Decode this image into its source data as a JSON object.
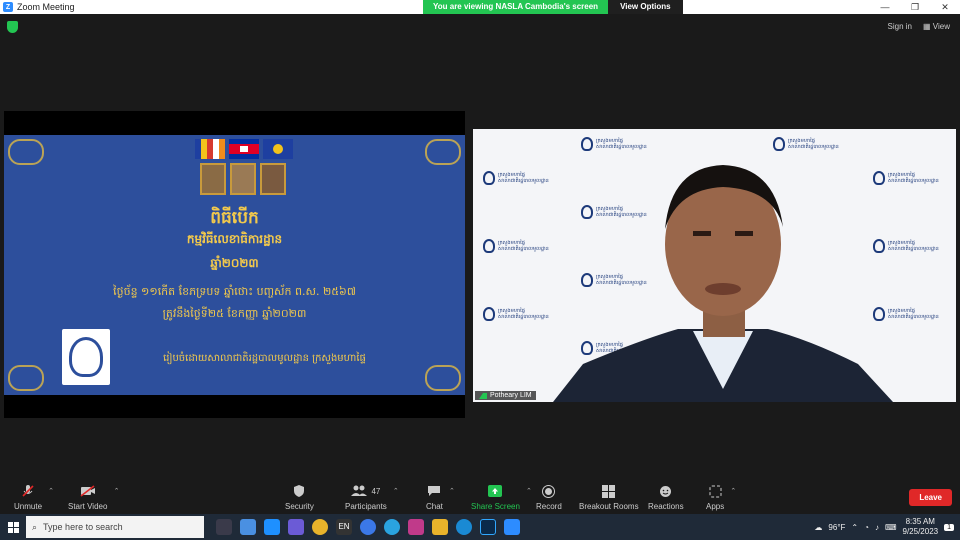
{
  "window": {
    "title": "Zoom Meeting",
    "controls": [
      "—",
      "❐",
      "✕"
    ]
  },
  "banner": {
    "message": "You are viewing NASLA Cambodia's screen",
    "options_label": "View Options"
  },
  "topbar": {
    "sign_in": "Sign in",
    "view": "View"
  },
  "slide": {
    "line1": "ពិធីបើក",
    "line2": "កម្មវិធីលេខាធិការដ្ឋាន",
    "line3": "ឆ្នាំ២០២៣",
    "line4": "ថ្ងៃច័ន្ទ ១១កើត ខែភទ្របទ ឆ្នាំថោះ បញ្ចស័ក ព.ស. ២៥៦៧",
    "line5": "ត្រូវនឹងថ្ងៃទី២៥ ខែកញ្ញា ឆ្នាំ២០២៣",
    "line6": "រៀបចំដោយសាលាជាតិរដ្ឋបាលមូលដ្ឋាន ក្រសួងមហាផ្ទៃ"
  },
  "video": {
    "participant_name": "Potheary LIM",
    "watermark_line1": "ក្រសួងមហាផ្ទៃ",
    "watermark_line2": "សាលាជាតិរដ្ឋបាលមូលដ្ឋាន"
  },
  "toolbar": {
    "unmute": "Unmute",
    "start_video": "Start Video",
    "security": "Security",
    "participants": "Participants",
    "participant_count": "47",
    "chat": "Chat",
    "share_screen": "Share Screen",
    "record": "Record",
    "breakout": "Breakout Rooms",
    "reactions": "Reactions",
    "apps": "Apps",
    "leave": "Leave"
  },
  "taskbar": {
    "search_placeholder": "Type here to search",
    "temperature": "96°F",
    "lang": "EN",
    "time": "8:35 AM",
    "date": "9/25/2023",
    "notif_count": "1"
  },
  "colors": {
    "accent_green": "#23c552",
    "leave_red": "#e02828",
    "slide_blue": "#2d4f9c",
    "gold": "#f2c94c"
  }
}
